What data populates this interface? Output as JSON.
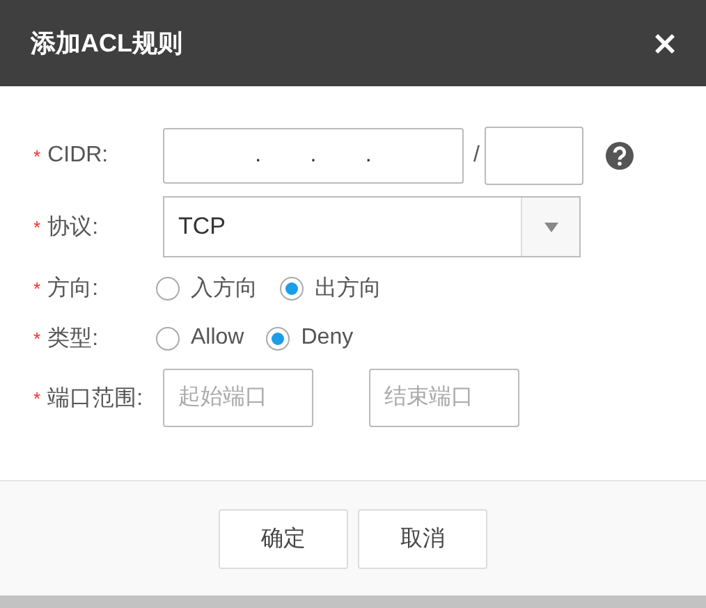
{
  "dialog": {
    "title": "添加ACL规则"
  },
  "form": [
    {
      "kind": "cidr",
      "required_mark": "*",
      "label": "CIDR:",
      "dots": [
        ".",
        ".",
        "."
      ],
      "separator": "/"
    },
    {
      "kind": "select",
      "required_mark": "*",
      "label": "协议:",
      "value": "TCP"
    },
    {
      "kind": "radio",
      "required_mark": "*",
      "label": "方向:",
      "options": [
        {
          "label": "入方向",
          "selected": false
        },
        {
          "label": "出方向",
          "selected": true
        }
      ]
    },
    {
      "kind": "radio",
      "required_mark": "*",
      "label": "类型:",
      "options": [
        {
          "label": "Allow",
          "selected": false
        },
        {
          "label": "Deny",
          "selected": true
        }
      ]
    },
    {
      "kind": "range",
      "required_mark": "*",
      "label": "端口范围:",
      "fields": [
        {
          "placeholder": "起始端口"
        },
        {
          "placeholder": "结束端口"
        }
      ]
    }
  ],
  "buttons": [
    "确定",
    "取消"
  ]
}
